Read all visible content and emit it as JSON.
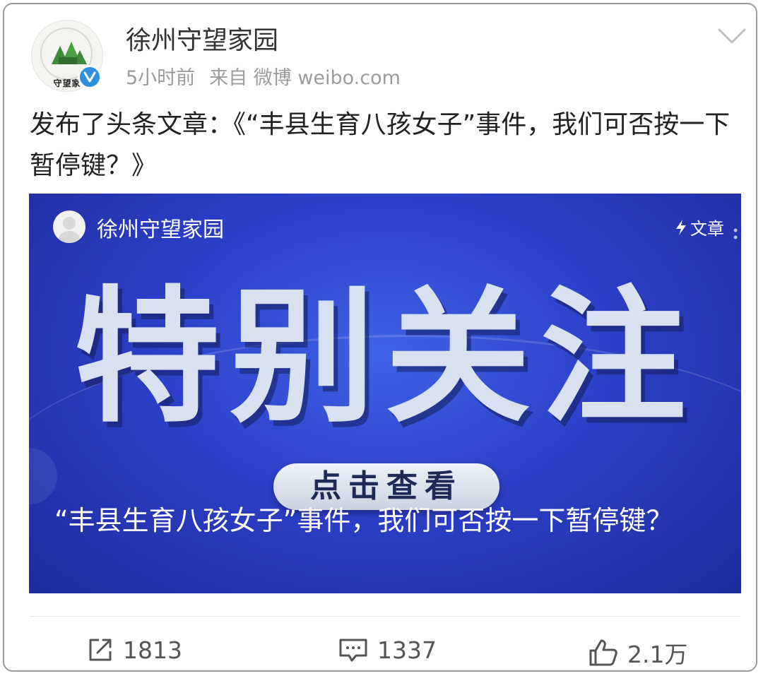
{
  "post": {
    "author": "徐州守望家园",
    "time": "5小时前",
    "source": "来自 微博 weibo.com",
    "avatar_text": "守望家",
    "text": "发布了头条文章：《“丰县生育八孩女子”事件，我们可否按一下暂停键？》"
  },
  "card": {
    "author": "徐州守望家园",
    "type_label": "文章",
    "headline": "特别关注",
    "cta": "点击查看",
    "title": "“丰县生育八孩女子”事件，我们可否按一下暂停键？"
  },
  "actions": {
    "repost_count": "1813",
    "comment_count": "1337",
    "like_count": "2.1万"
  },
  "colors": {
    "verified": "#2f8fe0",
    "card_blue": "#2d3fc8",
    "headline": "#d7e1ef"
  },
  "icons": [
    "chevron-down-icon",
    "verified-icon",
    "lightning-icon",
    "repost-icon",
    "comment-icon",
    "like-icon",
    "more-dots-icon"
  ]
}
